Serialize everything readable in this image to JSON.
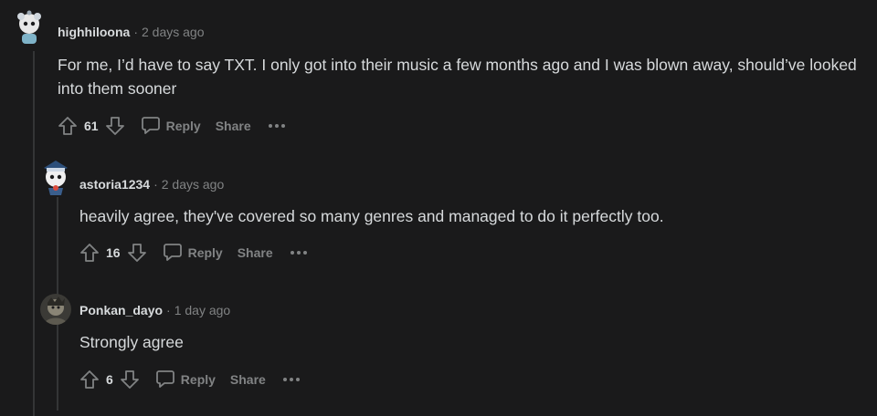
{
  "comments": [
    {
      "username": "highhiloona",
      "separator": "·",
      "timestamp": "2 days ago",
      "body": "For me, I’d have to say TXT. I only got into their music a few months ago and I was blown away, should’ve looked into them sooner",
      "score": "61",
      "reply_label": "Reply",
      "share_label": "Share",
      "avatar_icon": "snoo-avatar-icon"
    },
    {
      "username": "astoria1234",
      "separator": "·",
      "timestamp": "2 days ago",
      "body": "heavily agree, they've covered so many genres and managed to do it perfectly too.",
      "score": "16",
      "reply_label": "Reply",
      "share_label": "Share",
      "avatar_icon": "snoo-sailor-avatar-icon"
    },
    {
      "username": "Ponkan_dayo",
      "separator": "·",
      "timestamp": "1 day ago",
      "body": "Strongly agree",
      "score": "6",
      "reply_label": "Reply",
      "share_label": "Share",
      "avatar_icon": "user-photo-avatar-icon"
    }
  ],
  "colors": {
    "background": "#1a1a1b",
    "text": "#d7dadc",
    "muted": "#818384",
    "thread_line": "#343536"
  }
}
